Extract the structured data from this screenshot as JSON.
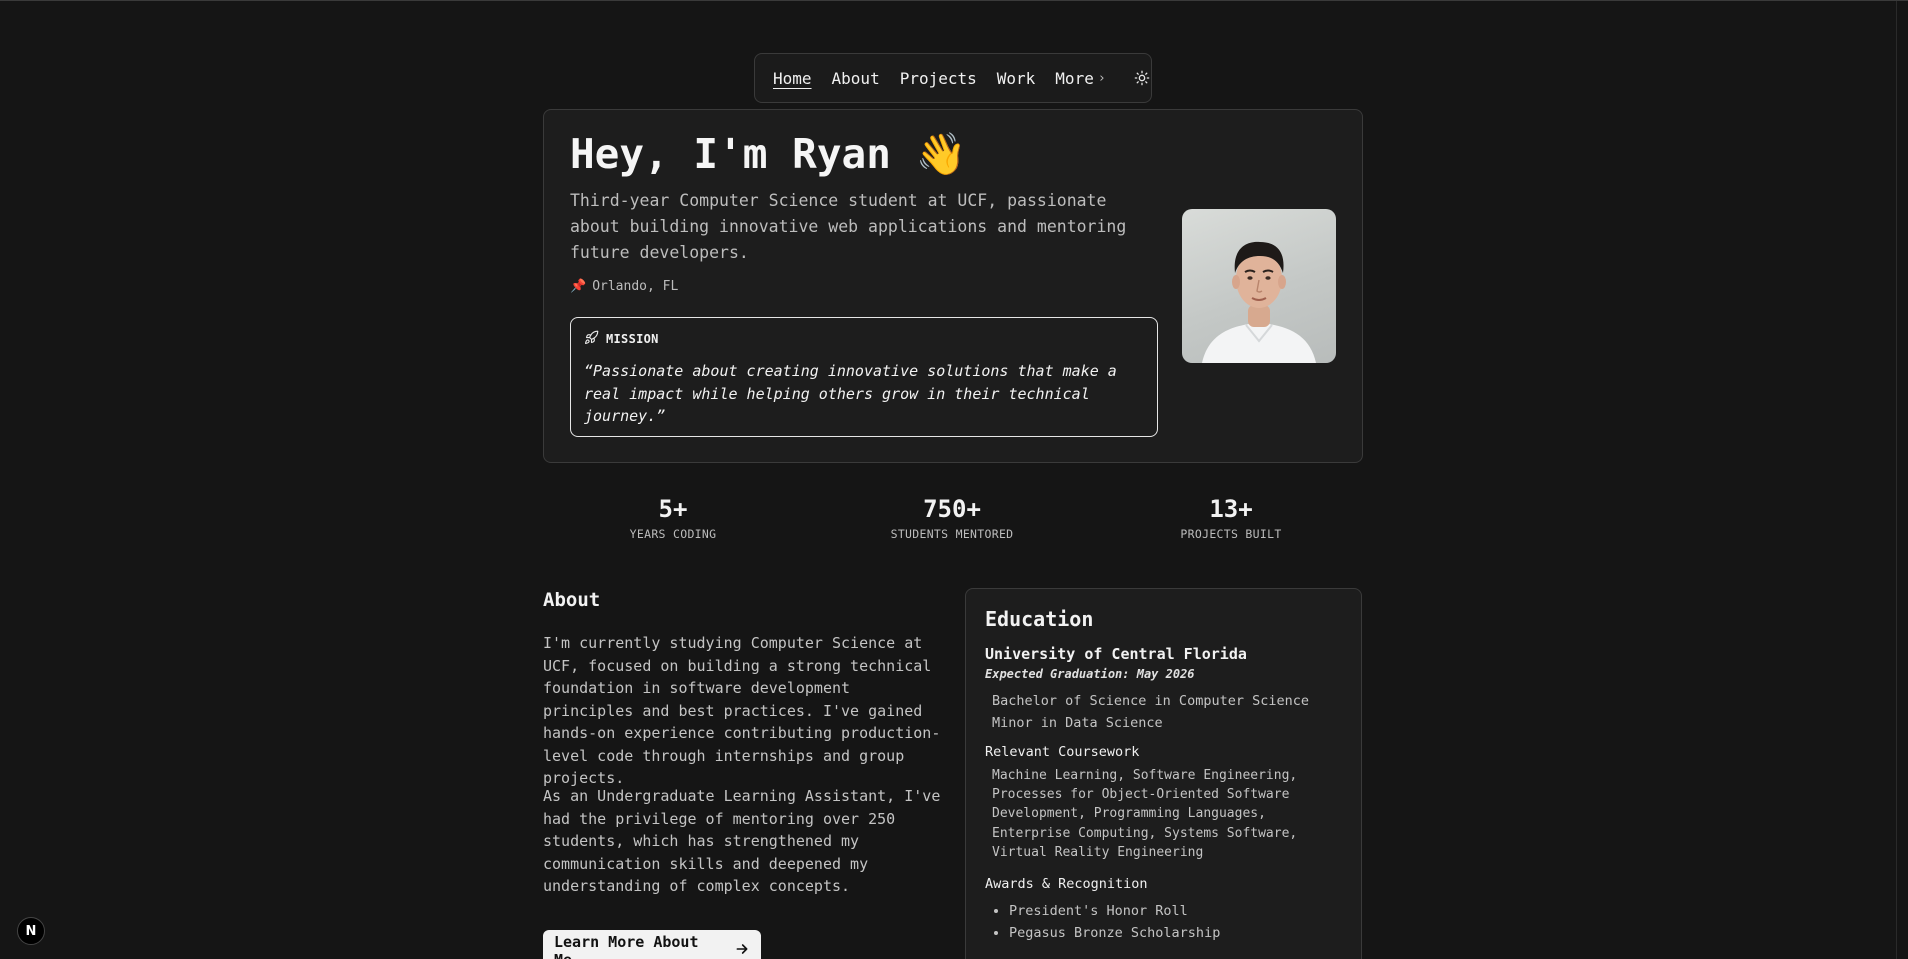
{
  "nav": {
    "items": [
      {
        "label": "Home",
        "active": true
      },
      {
        "label": "About"
      },
      {
        "label": "Projects"
      },
      {
        "label": "Work"
      },
      {
        "label": "More"
      }
    ],
    "theme_icon": "sun-icon"
  },
  "hero": {
    "title": "Hey, I'm Ryan 👋",
    "description": "Third-year Computer Science student at UCF, passionate about building innovative web applications and mentoring future developers.",
    "location_icon": "📌",
    "location": "Orlando, FL",
    "mission_label": "MISSION",
    "mission_icon": "rocket-icon",
    "mission_quote": "“Passionate about creating innovative solutions that make a real impact while helping others grow in their technical journey.”"
  },
  "stats": [
    {
      "value": "5+",
      "label": "YEARS CODING"
    },
    {
      "value": "750+",
      "label": "STUDENTS MENTORED"
    },
    {
      "value": "13+",
      "label": "PROJECTS BUILT"
    }
  ],
  "about": {
    "heading": "About",
    "paragraph_1": "I'm currently studying Computer Science at UCF, focused on building a strong technical foundation in software development principles and best practices. I've gained hands-on experience contributing production-level code through internships and group projects.",
    "paragraph_2": "As an Undergraduate Learning Assistant, I've had the privilege of mentoring over 250 students, which has strengthened my communication skills and deepened my understanding of complex concepts.",
    "button_label": "Learn More About Me"
  },
  "education": {
    "heading": "Education",
    "university": "University of Central Florida",
    "graduation": "Expected Graduation: May 2026",
    "degree": "Bachelor of Science in Computer Science",
    "minor": "Minor in Data Science",
    "coursework_heading": "Relevant Coursework",
    "coursework": "Machine Learning, Software Engineering, Processes for Object-Oriented Software Development, Programming Languages, Enterprise Computing, Systems Software, Virtual Reality Engineering",
    "awards_heading": "Awards & Recognition",
    "awards": [
      "President's Honor Roll",
      "Pegasus Bronze Scholarship"
    ]
  },
  "badge": {
    "label": "N"
  }
}
